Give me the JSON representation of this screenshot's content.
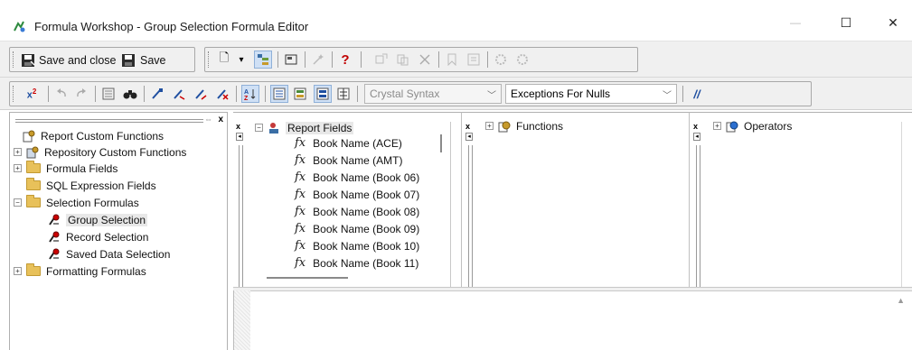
{
  "window": {
    "title": "Formula Workshop - Group Selection Formula Editor",
    "minimize_glyph": "—",
    "maximize_glyph": "☐",
    "close_glyph": "✕"
  },
  "toolbar1": {
    "save_and_close_label": "Save and close",
    "save_label": "Save",
    "new_glyph": "🗋",
    "dropdown_glyph": "▾",
    "help_glyph": "?"
  },
  "toolbar2": {
    "syntax_combo": {
      "value": "Crystal Syntax",
      "disabled": true
    },
    "nulls_combo": {
      "value": "Exceptions For Nulls"
    },
    "comment_glyph": "//"
  },
  "left_tree": {
    "items": [
      {
        "label": "Report Custom Functions",
        "icon": "report-functions-icon",
        "expander": ""
      },
      {
        "label": "Repository Custom Functions",
        "icon": "repository-functions-icon",
        "expander": "+"
      },
      {
        "label": "Formula Fields",
        "icon": "folder-icon",
        "expander": "+"
      },
      {
        "label": "SQL Expression Fields",
        "icon": "folder-icon",
        "expander": ""
      },
      {
        "label": "Selection Formulas",
        "icon": "folder-open-icon",
        "expander": "−"
      },
      {
        "label": "Group Selection",
        "icon": "selection-formula-icon",
        "expander": "",
        "selected": true
      },
      {
        "label": "Record Selection",
        "icon": "selection-formula-icon",
        "expander": ""
      },
      {
        "label": "Saved Data Selection",
        "icon": "selection-formula-icon",
        "expander": ""
      },
      {
        "label": "Formatting Formulas",
        "icon": "folder-icon",
        "expander": "+"
      }
    ]
  },
  "fields_pane": {
    "root_label": "Report Fields",
    "root_expander": "−",
    "fx_glyph": "fx",
    "fields": [
      "Book Name (ACE)",
      "Book Name (AMT)",
      "Book Name (Book 06)",
      "Book Name (Book 07)",
      "Book Name (Book 08)",
      "Book Name (Book 09)",
      "Book Name (Book 10)",
      "Book Name (Book 11)"
    ]
  },
  "functions_pane": {
    "root_label": "Functions",
    "root_expander": "+"
  },
  "operators_pane": {
    "root_label": "Operators",
    "root_expander": "+"
  },
  "pane_controls": {
    "close_glyph": "x",
    "restore_glyph": "↔",
    "collapse_glyph": "◂"
  },
  "editor": {
    "content": "",
    "scroll_up_glyph": "▲"
  },
  "colors": {
    "toolbar_bg": "#f0f0f0",
    "folder": "#e8c15a",
    "help_red": "#c00000",
    "pressed": "#cfe0f5"
  }
}
